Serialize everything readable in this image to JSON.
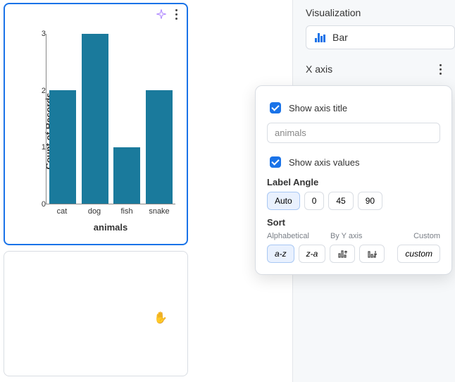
{
  "chart_data": {
    "type": "bar",
    "categories": [
      "cat",
      "dog",
      "fish",
      "snake"
    ],
    "values": [
      2,
      3,
      1,
      2
    ],
    "title": "",
    "xlabel": "animals",
    "ylabel": "Count of Records",
    "ylim": [
      0,
      3
    ],
    "yticks": [
      0,
      1,
      2,
      3
    ]
  },
  "right_panel": {
    "visualization": {
      "header": "Visualization",
      "selected": "Bar"
    },
    "xaxis": {
      "header": "X axis"
    }
  },
  "popover": {
    "show_title": {
      "label": "Show axis title",
      "checked": true
    },
    "title_input": {
      "value": "animals"
    },
    "show_values": {
      "label": "Show axis values",
      "checked": true
    },
    "label_angle": {
      "header": "Label Angle",
      "options": [
        "Auto",
        "0",
        "45",
        "90"
      ],
      "selected": "Auto"
    },
    "sort": {
      "header": "Sort",
      "group_headers": [
        "Alphabetical",
        "By Y axis",
        "Custom"
      ],
      "buttons": {
        "az": "a-z",
        "za": "z-a",
        "custom": "custom"
      },
      "selected": "az"
    }
  }
}
